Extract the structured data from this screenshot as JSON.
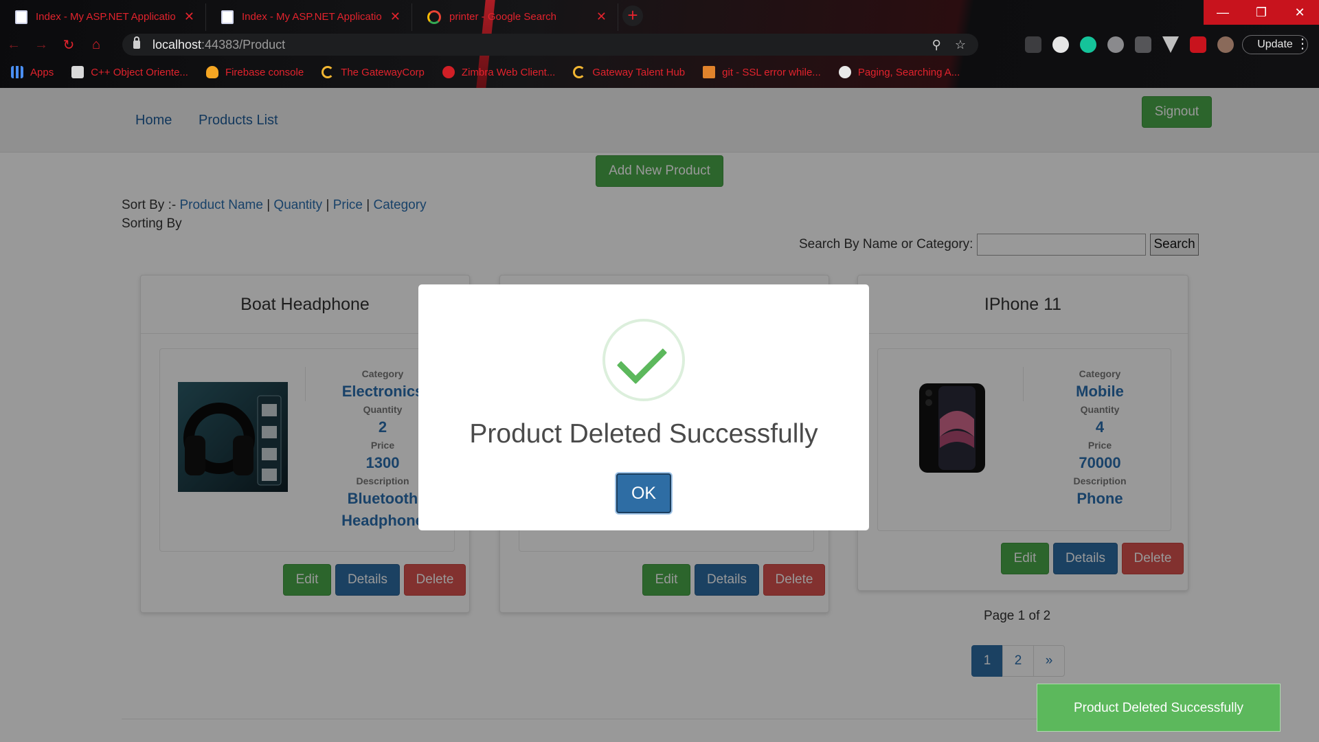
{
  "browser": {
    "tabs": [
      {
        "title": "Index - My ASP.NET Application",
        "icon": "page-icon"
      },
      {
        "title": "Index - My ASP.NET Application",
        "icon": "page-icon"
      },
      {
        "title": "printer - Google Search",
        "icon": "google-icon"
      }
    ],
    "tab_close": "✕",
    "new_tab": "+",
    "window_controls": [
      "—",
      "❐",
      "✕"
    ],
    "url_host": "localhost",
    "url_rest": ":44383/Product",
    "update_label": "Update",
    "bookmarks": [
      {
        "label": "Apps",
        "icon": "apps"
      },
      {
        "label": "C++ Object Oriente...",
        "icon": "cpp"
      },
      {
        "label": "Firebase console",
        "icon": "fire"
      },
      {
        "label": "The GatewayCorp",
        "icon": "gw"
      },
      {
        "label": "Zimbra Web Client...",
        "icon": "zim"
      },
      {
        "label": "Gateway Talent Hub",
        "icon": "gw"
      },
      {
        "label": "git - SSL error while...",
        "icon": "git"
      },
      {
        "label": "Paging, Searching A...",
        "icon": "pag"
      }
    ],
    "accent": "#e2232d"
  },
  "nav": {
    "home": "Home",
    "products_list": "Products List",
    "signout": "Signout"
  },
  "add_new_label": "Add New Product",
  "sort": {
    "prefix": "Sort By :-",
    "product_name": "Product Name",
    "quantity": "Quantity",
    "price": "Price",
    "category": "Category",
    "separator": "|",
    "sorting_by": "Sorting By"
  },
  "search": {
    "label": "Search By Name or Category:",
    "value": "",
    "button": "Search"
  },
  "labels": {
    "category": "Category",
    "quantity": "Quantity",
    "price": "Price",
    "description": "Description"
  },
  "products": [
    {
      "name": "Boat Headphone",
      "category": "Electronics",
      "quantity": "2",
      "price": "1300",
      "description_line1": "Bluetooth",
      "description_line2": "Headphone"
    },
    {
      "name": "IPhone 11",
      "category": "Mobile",
      "quantity": "4",
      "price": "70000",
      "description_line1": "Phone",
      "description_line2": ""
    }
  ],
  "card_buttons": {
    "edit": "Edit",
    "details": "Details",
    "delete": "Delete"
  },
  "pagination": {
    "text": "Page 1 of 2",
    "pages": [
      "1",
      "2",
      "»"
    ],
    "active": "1"
  },
  "modal": {
    "title": "Product Deleted Successfully",
    "ok": "OK"
  },
  "toast": "Product Deleted Successfully",
  "colors": {
    "success": "#5cb85c",
    "primary": "#2e6da4",
    "danger": "#d9534f",
    "link": "#2a6fb0"
  }
}
